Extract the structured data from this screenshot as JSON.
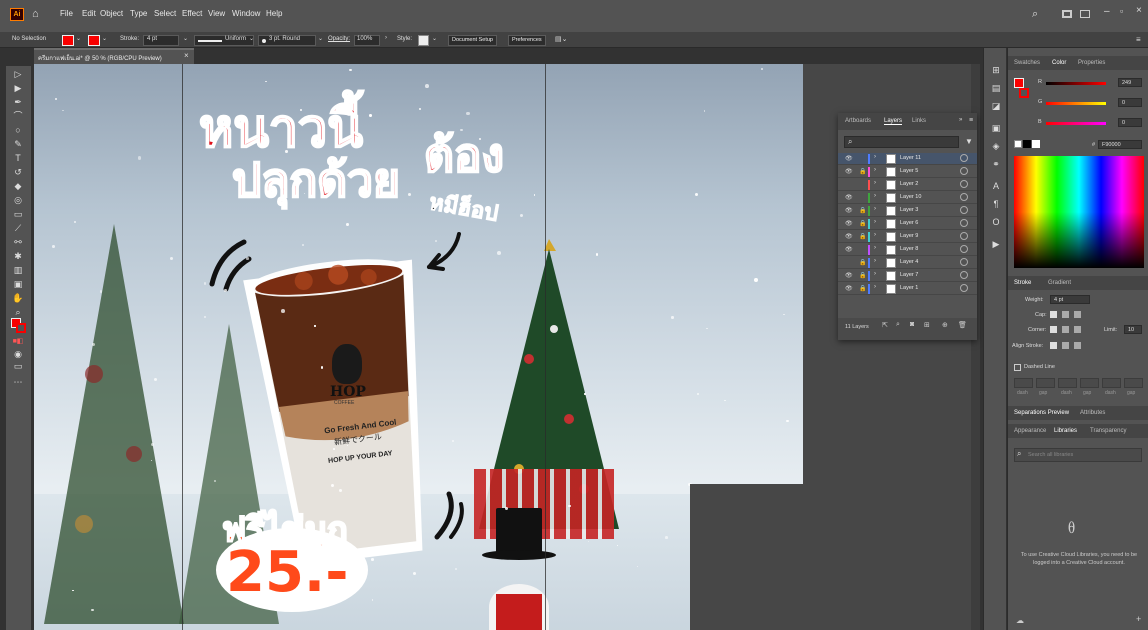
{
  "menu": {
    "app_logo": "Ai",
    "items": [
      "File",
      "Edit",
      "Object",
      "Type",
      "Select",
      "Effect",
      "View",
      "Window",
      "Help"
    ]
  },
  "control_bar": {
    "selection": "No Selection",
    "stroke_label": "Stroke:",
    "stroke_value": "4 pt",
    "profile": "Uniform",
    "brush": "3 pt. Round",
    "opacity_label": "Opacity:",
    "opacity_value": "100%",
    "style_label": "Style:",
    "doc_setup": "Document Setup",
    "preferences": "Preferences"
  },
  "document": {
    "tab_title": "ครีมกาแฟเย็น.ai* @ 50 % (RGB/CPU Preview)",
    "close": "×"
  },
  "artwork": {
    "headline_1": "หนาวนี้",
    "headline_2": "ต้อง",
    "headline_3": "ปลุกด้วย",
    "tag": "หมีฮ็อป",
    "cup_brand": "HOP",
    "cup_sub": "COFFEE",
    "cup_line1": "Go Fresh And Cool",
    "cup_line2": "新鮮でクール",
    "cup_line3": "HOP UP YOUR DAY",
    "promo": "ฟรีไข่มุก",
    "price": "25.-"
  },
  "layers_panel": {
    "tabs": [
      "Artboards",
      "Layers",
      "Links"
    ],
    "active_tab": "Layers",
    "layers": [
      {
        "name": "Layer 11",
        "color": "#4f7cff",
        "locked": false,
        "visible": true,
        "selected": true
      },
      {
        "name": "Layer 5",
        "color": "#ff4fd8",
        "locked": true,
        "visible": true,
        "selected": false
      },
      {
        "name": "Layer 2",
        "color": "#ff4f4f",
        "locked": false,
        "visible": false,
        "selected": false
      },
      {
        "name": "Layer 10",
        "color": "#3fa53f",
        "locked": false,
        "visible": true,
        "selected": false
      },
      {
        "name": "Layer 3",
        "color": "#3fa53f",
        "locked": true,
        "visible": true,
        "selected": false
      },
      {
        "name": "Layer 6",
        "color": "#3fd0d0",
        "locked": true,
        "visible": true,
        "selected": false
      },
      {
        "name": "Layer 9",
        "color": "#3fd0d0",
        "locked": true,
        "visible": true,
        "selected": false
      },
      {
        "name": "Layer 8",
        "color": "#c04fff",
        "locked": false,
        "visible": true,
        "selected": false
      },
      {
        "name": "Layer 4",
        "color": "#4f7cff",
        "locked": true,
        "visible": false,
        "selected": false
      },
      {
        "name": "Layer 7",
        "color": "#4f7cff",
        "locked": true,
        "visible": true,
        "selected": false
      },
      {
        "name": "Layer 1",
        "color": "#4f7cff",
        "locked": true,
        "visible": true,
        "selected": false
      }
    ],
    "count": "11 Layers"
  },
  "color_panel": {
    "tabs": [
      "Swatches",
      "Color",
      "Properties"
    ],
    "active_tab": "Color",
    "r": "249",
    "g": "0",
    "b": "0",
    "hex_prefix": "#",
    "hex": "F90000"
  },
  "stroke_panel": {
    "tabs": [
      "Stroke",
      "Gradient"
    ],
    "weight_label": "Weight:",
    "weight_value": "4 pt",
    "cap_label": "Cap:",
    "corner_label": "Corner:",
    "limit_label": "Limit:",
    "limit_value": "10",
    "align_label": "Align Stroke:",
    "dashed_label": "Dashed Line",
    "dash_labels": [
      "dash",
      "gap",
      "dash",
      "gap",
      "dash",
      "gap"
    ]
  },
  "separations": {
    "tabs": [
      "Separations Preview",
      "Attributes"
    ]
  },
  "libraries": {
    "tabs": [
      "Appearance",
      "Libraries",
      "Transparency"
    ],
    "active_tab": "Libraries",
    "search_placeholder": "Search all libraries",
    "message": "To use Creative Cloud Libraries, you need to be logged into a Creative Cloud account."
  },
  "colors": {
    "accent_red": "#F90000",
    "menubar": "#535353",
    "panel": "#535353",
    "promo_orange": "#ff4a1a"
  }
}
